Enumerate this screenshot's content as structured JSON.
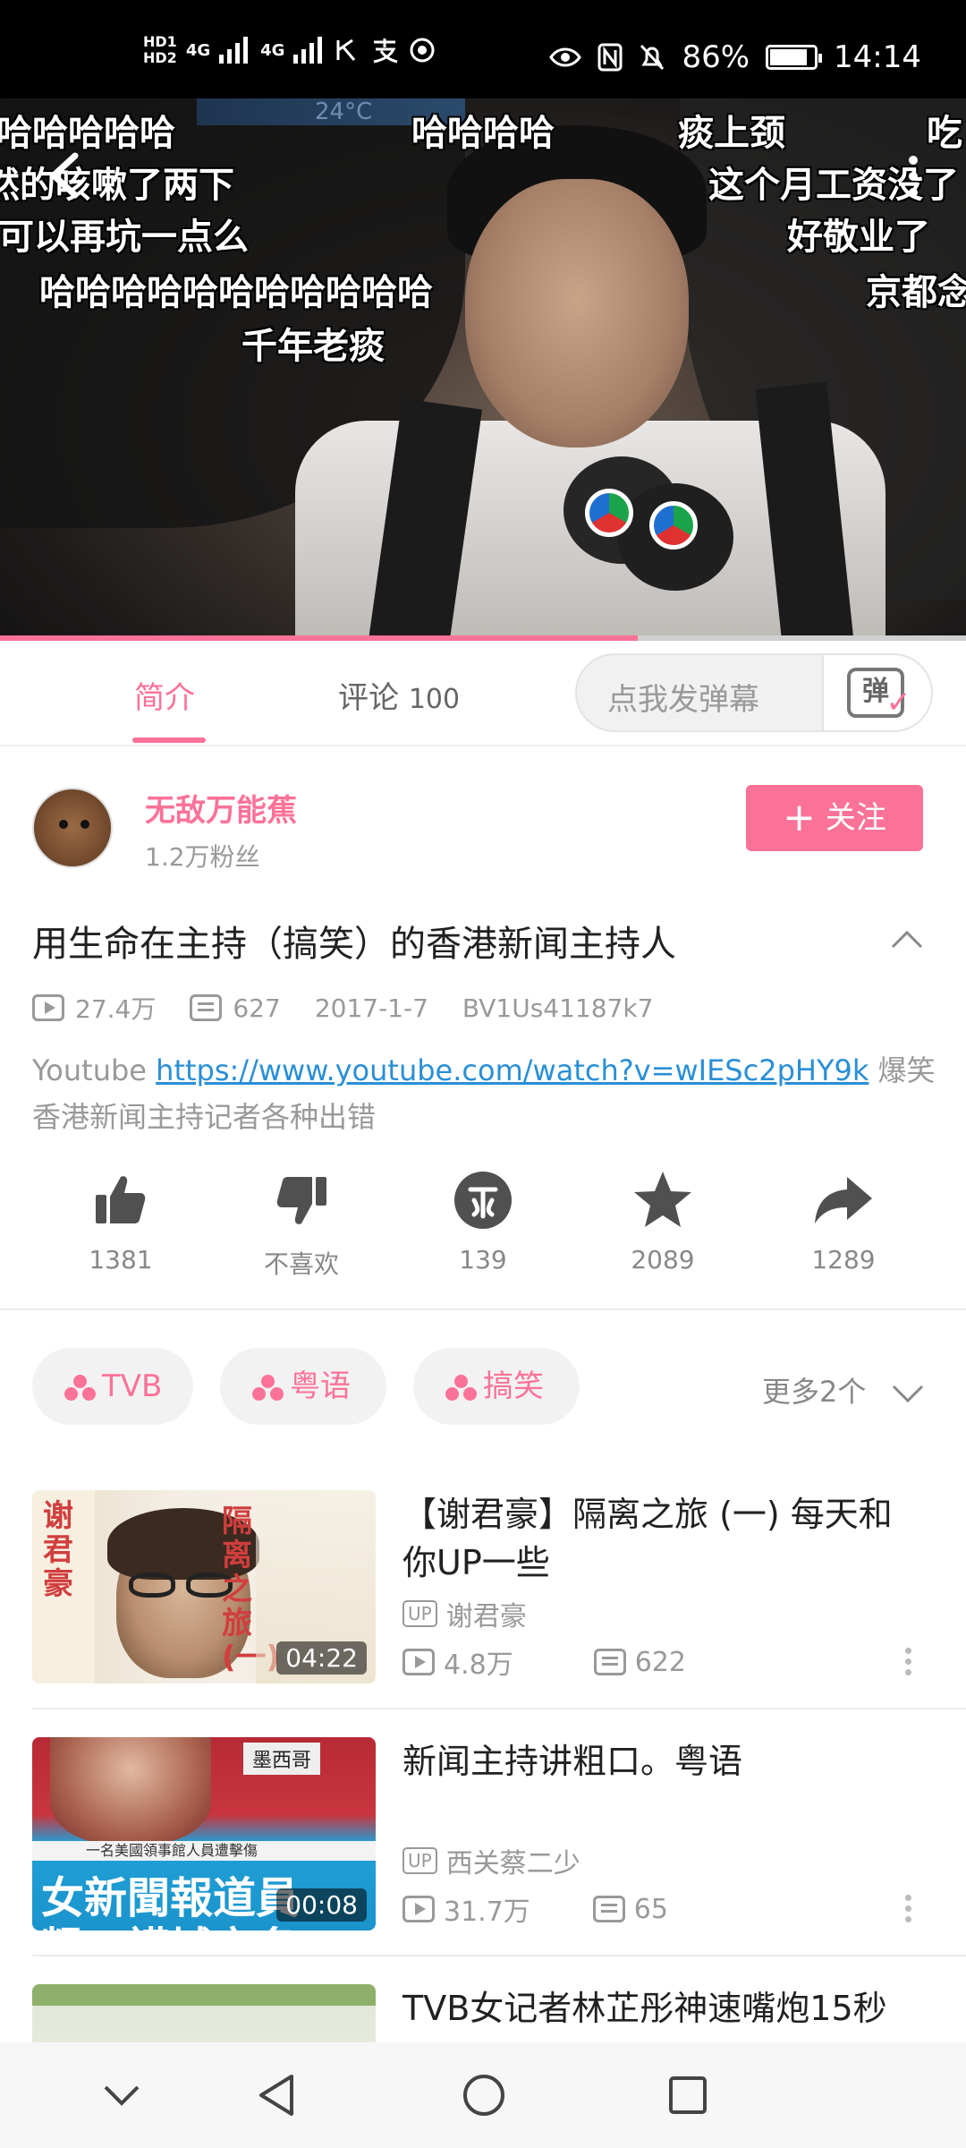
{
  "status_bar": {
    "hd1": "HD1",
    "hd2": "HD2",
    "net1": "4G",
    "net2": "4G",
    "battery_percent": "86%",
    "battery_level": 0.86,
    "time": "14:14"
  },
  "player": {
    "danmaku": [
      "哈哈哈哈哈",
      "哈哈哈哈",
      "痰上颈",
      "吃",
      "然的咳嗽了两下",
      "这个月工资没了",
      "可以再坑一点么",
      "好敬业了",
      "哈哈哈哈哈哈哈哈哈哈哈",
      "京都念",
      "千年老痰"
    ],
    "hud_text": [
      "24°C"
    ],
    "progress": 0.66
  },
  "tabs": {
    "intro": "简介",
    "comments": "评论",
    "comments_count": "100",
    "danmaku_placeholder": "点我发弹幕",
    "danmaku_icon_char": "弹"
  },
  "author": {
    "name": "无敌万能蕉",
    "fans": "1.2万粉丝",
    "follow_label": "关注",
    "follow_plus": "+"
  },
  "video": {
    "title": "用生命在主持（搞笑）的香港新闻主持人",
    "views": "27.4万",
    "danmaku_count": "627",
    "date": "2017-1-7",
    "bvid": "BV1Us41187k7",
    "desc_prefix": "Youtube ",
    "desc_link": "https://www.youtube.com/watch?v=wIESc2pHY9k",
    "desc_suffix": " 爆笑香港新闻主持记者各种出错"
  },
  "actions": [
    {
      "icon": "thumbs-up-icon",
      "label": "1381"
    },
    {
      "icon": "thumbs-down-icon",
      "label": "不喜欢"
    },
    {
      "icon": "coin-icon",
      "label": "139"
    },
    {
      "icon": "star-icon",
      "label": "2089"
    },
    {
      "icon": "share-icon",
      "label": "1289"
    }
  ],
  "tags": {
    "items": [
      "TVB",
      "粤语",
      "搞笑"
    ],
    "more": "更多2个"
  },
  "recommendations": [
    {
      "title": "【谢君豪】隔离之旅 (一) 每天和你UP一些",
      "up_badge": "UP",
      "uploader": "谢君豪",
      "views": "4.8万",
      "danmaku": "622",
      "duration": "04:22",
      "thumb_text_left": "谢君豪",
      "thumb_text_right": "隔离之旅(一)"
    },
    {
      "title": "新闻主持讲粗口。粤语",
      "up_badge": "UP",
      "uploader": "西关蔡二少",
      "views": "31.7万",
      "danmaku": "65",
      "duration": "00:08",
      "thumb_caption": "女新聞報道員",
      "thumb_caption2": "粗口講城市名",
      "thumb_tag": "墨西哥",
      "thumb_strip": "一名美國領事館人員遭擊傷"
    },
    {
      "title": "TVB女记者林芷彤神速嘴炮15秒"
    }
  ],
  "nav": {
    "buttons": [
      "chevron-down-icon",
      "back-triangle-icon",
      "home-circle-icon",
      "recents-square-icon"
    ]
  }
}
